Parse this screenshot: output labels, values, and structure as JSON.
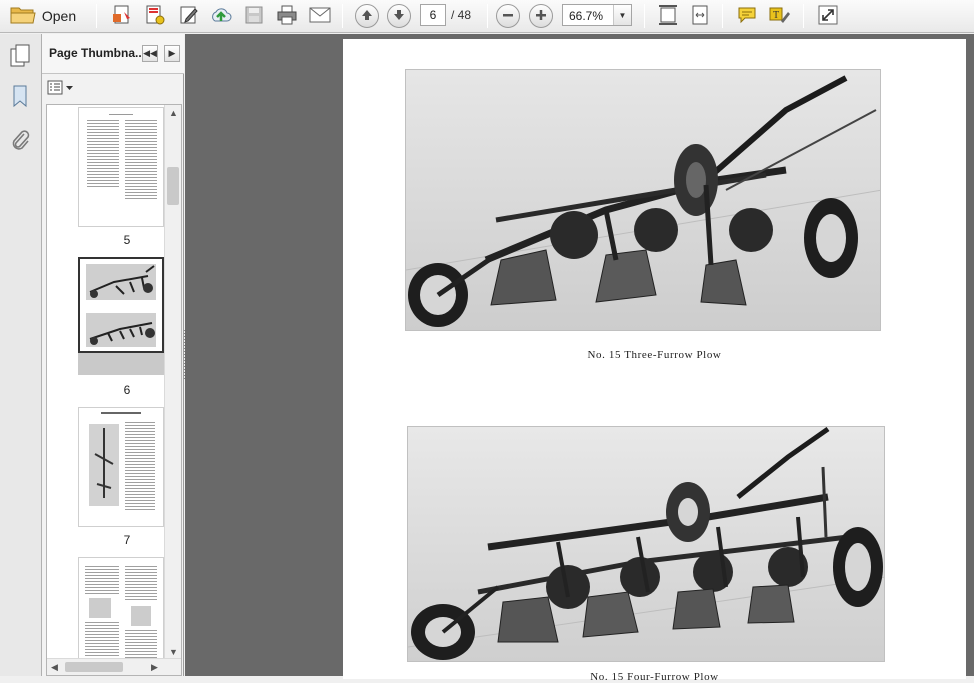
{
  "toolbar": {
    "open_label": "Open",
    "current_page": "6",
    "page_total": "/ 48",
    "zoom": "66.7%"
  },
  "panel": {
    "title": "Page Thumbna...",
    "thumbnails": [
      {
        "label": "5"
      },
      {
        "label": "6"
      },
      {
        "label": "7"
      },
      {
        "label": ""
      }
    ]
  },
  "document": {
    "caption_top": "No. 15 Three-Furrow Plow",
    "caption_bottom": "No. 15 Four-Furrow Plow"
  },
  "colors": {
    "doc_background": "#696969",
    "accent_green": "#2f9b3c",
    "highlight_yellow": "#e8c21c"
  },
  "icons": [
    "folder-icon",
    "create-pdf-icon",
    "settings-doc-icon",
    "edit-icon",
    "upload-icon",
    "save-icon",
    "print-icon",
    "email-icon",
    "prev-page-icon",
    "next-page-icon",
    "zoom-out-icon",
    "zoom-in-icon",
    "fit-page-icon",
    "fit-width-icon",
    "comment-icon",
    "highlight-icon",
    "expand-icon",
    "pages-icon",
    "bookmark-icon",
    "attachment-icon"
  ]
}
